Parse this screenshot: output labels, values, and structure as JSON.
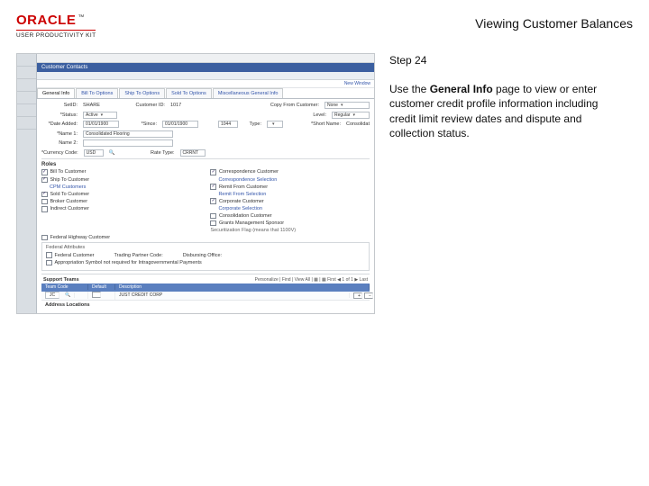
{
  "header": {
    "brand_main": "ORACLE",
    "brand_tm": "™",
    "brand_sub": "USER PRODUCTIVITY KIT",
    "title": "Viewing Customer Balances"
  },
  "instruction": {
    "step_label": "Step 24",
    "text_before_bold": "Use the ",
    "bold": "General Info",
    "text_after_bold": " page to view or enter customer credit profile information including credit limit review dates and dispute and collection status."
  },
  "app": {
    "crumb": "",
    "bluebar_title": "Customer Contacts",
    "newwin": "New Window",
    "tabs": [
      "General Info",
      "Bill To Options",
      "Ship To Options",
      "Sold To Options",
      "Miscellaneous General Info"
    ],
    "active_tab_index": 0,
    "fields": {
      "setid_label": "SetID:",
      "setid_value": "SHARE",
      "custid_label": "Customer ID:",
      "custid_value": "1017",
      "status_label": "*Status:",
      "status_value": "Active",
      "dateadded_label": "*Date Added:",
      "dateadded_value": "01/01/1900",
      "since_label": "*Since:",
      "since_value": "01/01/1900",
      "type_label": "Type:",
      "type_value": "",
      "name1_label": "*Name 1:",
      "name1_value": "Consolidated Flooring",
      "name2_label": "Name 2:",
      "currency_label": "*Currency Code:",
      "currency_value": "USD",
      "ratetype_label": "Rate Type:",
      "ratetype_value": "CRRNT",
      "linkcfg_label": "Copy From Customer:",
      "linkcfg_value": "None",
      "level_label": "Level:",
      "level_value": "Regular",
      "shortname_label": "*Short Name:",
      "shortname_value": "Consolidat",
      "blank1": "1044"
    },
    "roles": {
      "heading": "Roles",
      "left": [
        {
          "label": "Bill To Customer",
          "checked": true
        },
        {
          "label": "Ship To Customer",
          "checked": true,
          "sub": "CPM Customers"
        },
        {
          "label": "Sold To Customer",
          "checked": true
        },
        {
          "label": "Broker Customer",
          "checked": false
        },
        {
          "label": "Indirect Customer",
          "checked": false
        }
      ],
      "right": [
        {
          "label": "Correspondence Customer",
          "checked": true,
          "sub": "Correspondence Selection"
        },
        {
          "label": "Remit From Customer",
          "checked": true,
          "sub": "Remit From Selection"
        },
        {
          "label": "Corporate Customer",
          "checked": true,
          "sub": "Corporate Selection"
        },
        {
          "label": "Consolidation Customer",
          "checked": false
        },
        {
          "label": "Grants Management Sponsor",
          "checked": false
        }
      ],
      "note": "Federal Highway Customer",
      "rowx": "Securitization Flag (means that 1100V)"
    },
    "federal": {
      "heading": "Federal Attributes",
      "items": [
        {
          "label": "Federal Customer",
          "checked": false
        },
        {
          "label": "Trading Partner Code:",
          "checked": false
        },
        {
          "label": "Disbursing Office:",
          "checked": false
        }
      ],
      "note": "Appropriation Symbol not required for Intragovernmental Payments"
    },
    "teams": {
      "heading": "Support Teams",
      "toolbar": "Personalize | Find | View All | ▦ | ▦    First ◀ 1 of 1 ▶ Last",
      "col1": "Team Code",
      "col2": "Default",
      "col3": "Description",
      "row_code": "JC",
      "row_desc": "JUST CREDIT CORP"
    },
    "address": {
      "heading": "Address Locations"
    }
  }
}
